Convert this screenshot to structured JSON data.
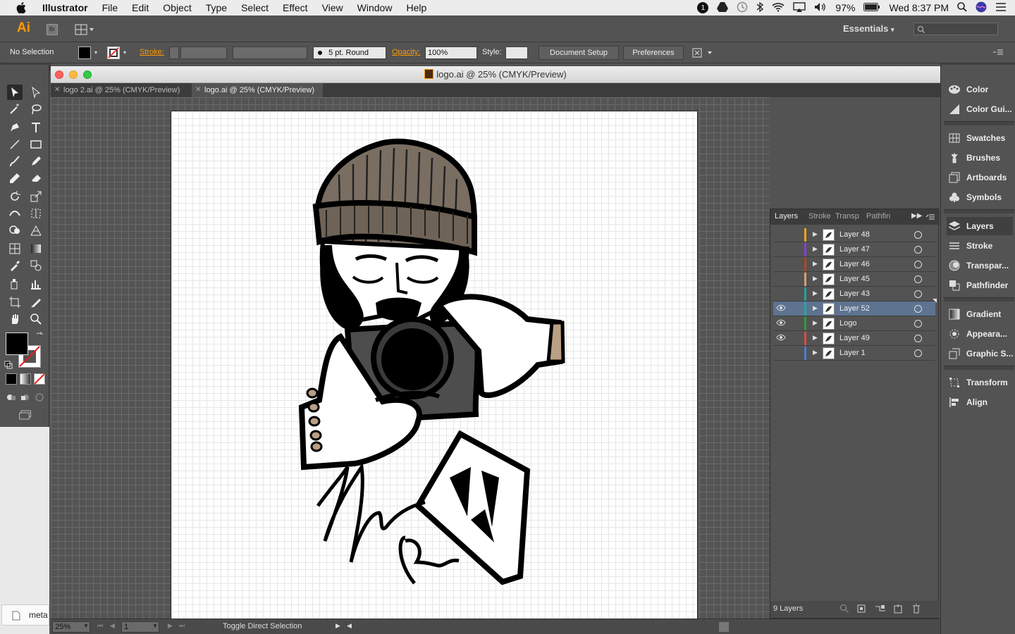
{
  "menubar": {
    "app_name": "Illustrator",
    "items": [
      "File",
      "Edit",
      "Object",
      "Type",
      "Select",
      "Effect",
      "View",
      "Window",
      "Help"
    ],
    "battery": "97%",
    "clock": "Wed 8:37 PM"
  },
  "appbar": {
    "logo": "Ai",
    "bridge": "Br",
    "workspace": "Essentials"
  },
  "controlbar": {
    "selection": "No Selection",
    "stroke_label": "Stroke:",
    "brush": "5 pt. Round",
    "opacity_label": "Opacity:",
    "opacity_value": "100%",
    "style_label": "Style:",
    "document_setup": "Document Setup",
    "preferences": "Preferences"
  },
  "document": {
    "title": "logo.ai @ 25% (CMYK/Preview)",
    "tabs": [
      {
        "label": "logo 2.ai @ 25% (CMYK/Preview)"
      },
      {
        "label": "logo.ai @ 25% (CMYK/Preview)"
      }
    ]
  },
  "statusbar": {
    "zoom": "25%",
    "artboard": "1",
    "status": "Toggle Direct Selection"
  },
  "layers_panel": {
    "tabs": [
      "Layers",
      "Stroke",
      "Transp",
      "Pathfin"
    ],
    "layers": [
      {
        "name": "Layer 48",
        "color": "#f7a21b",
        "visible": false,
        "selected": false
      },
      {
        "name": "Layer 47",
        "color": "#8a3ddb",
        "visible": false,
        "selected": false
      },
      {
        "name": "Layer 46",
        "color": "#b5451b",
        "visible": false,
        "selected": false
      },
      {
        "name": "Layer 45",
        "color": "#d8a06a",
        "visible": false,
        "selected": false
      },
      {
        "name": "Layer 43",
        "color": "#1fa39a",
        "visible": false,
        "selected": false
      },
      {
        "name": "Layer 52",
        "color": "#2aa3a3",
        "visible": true,
        "selected": true
      },
      {
        "name": "Logo",
        "color": "#2e9a3a",
        "visible": true,
        "selected": false
      },
      {
        "name": "Layer 49",
        "color": "#e2473d",
        "visible": true,
        "selected": false
      },
      {
        "name": "Layer 1",
        "color": "#4a7ee0",
        "visible": false,
        "selected": false
      }
    ],
    "count": "9 Layers"
  },
  "dock": {
    "items": [
      "Color",
      "Color Gui...",
      "Swatches",
      "Brushes",
      "Artboards",
      "Symbols",
      "Layers",
      "Stroke",
      "Transpar...",
      "Pathfinder",
      "Gradient",
      "Appeara...",
      "Graphic S...",
      "Transform",
      "Align"
    ]
  },
  "finder": {
    "label": "meta"
  }
}
